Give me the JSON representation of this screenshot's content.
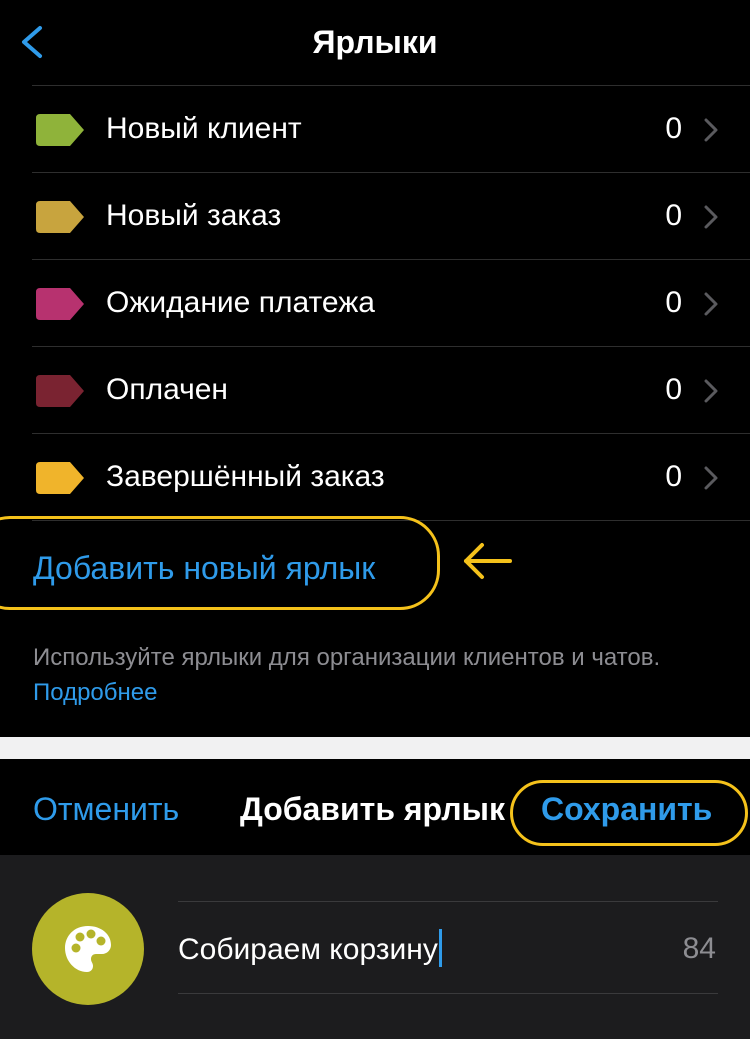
{
  "header": {
    "title": "Ярлыки"
  },
  "labels": [
    {
      "name": "Новый клиент",
      "count": "0",
      "color": "#8fb33a"
    },
    {
      "name": "Новый заказ",
      "count": "0",
      "color": "#c8a43e"
    },
    {
      "name": "Ожидание платежа",
      "count": "0",
      "color": "#b7326f"
    },
    {
      "name": "Оплачен",
      "count": "0",
      "color": "#7a2331"
    },
    {
      "name": "Завершённый заказ",
      "count": "0",
      "color": "#f0b42b"
    }
  ],
  "add_label_link": "Добавить новый ярлык",
  "hint": {
    "text": "Используйте ярлыки для организации клиентов и чатов.",
    "link": "Подробнее"
  },
  "sheet": {
    "cancel_label": "Отменить",
    "title": "Добавить ярлык",
    "save_label": "Сохранить",
    "name_value": "Собираем корзину",
    "remaining_chars": "84",
    "selected_color": "#b5b42a"
  },
  "colors": {
    "accent": "#2f9bea",
    "highlight": "#f5c21b"
  }
}
